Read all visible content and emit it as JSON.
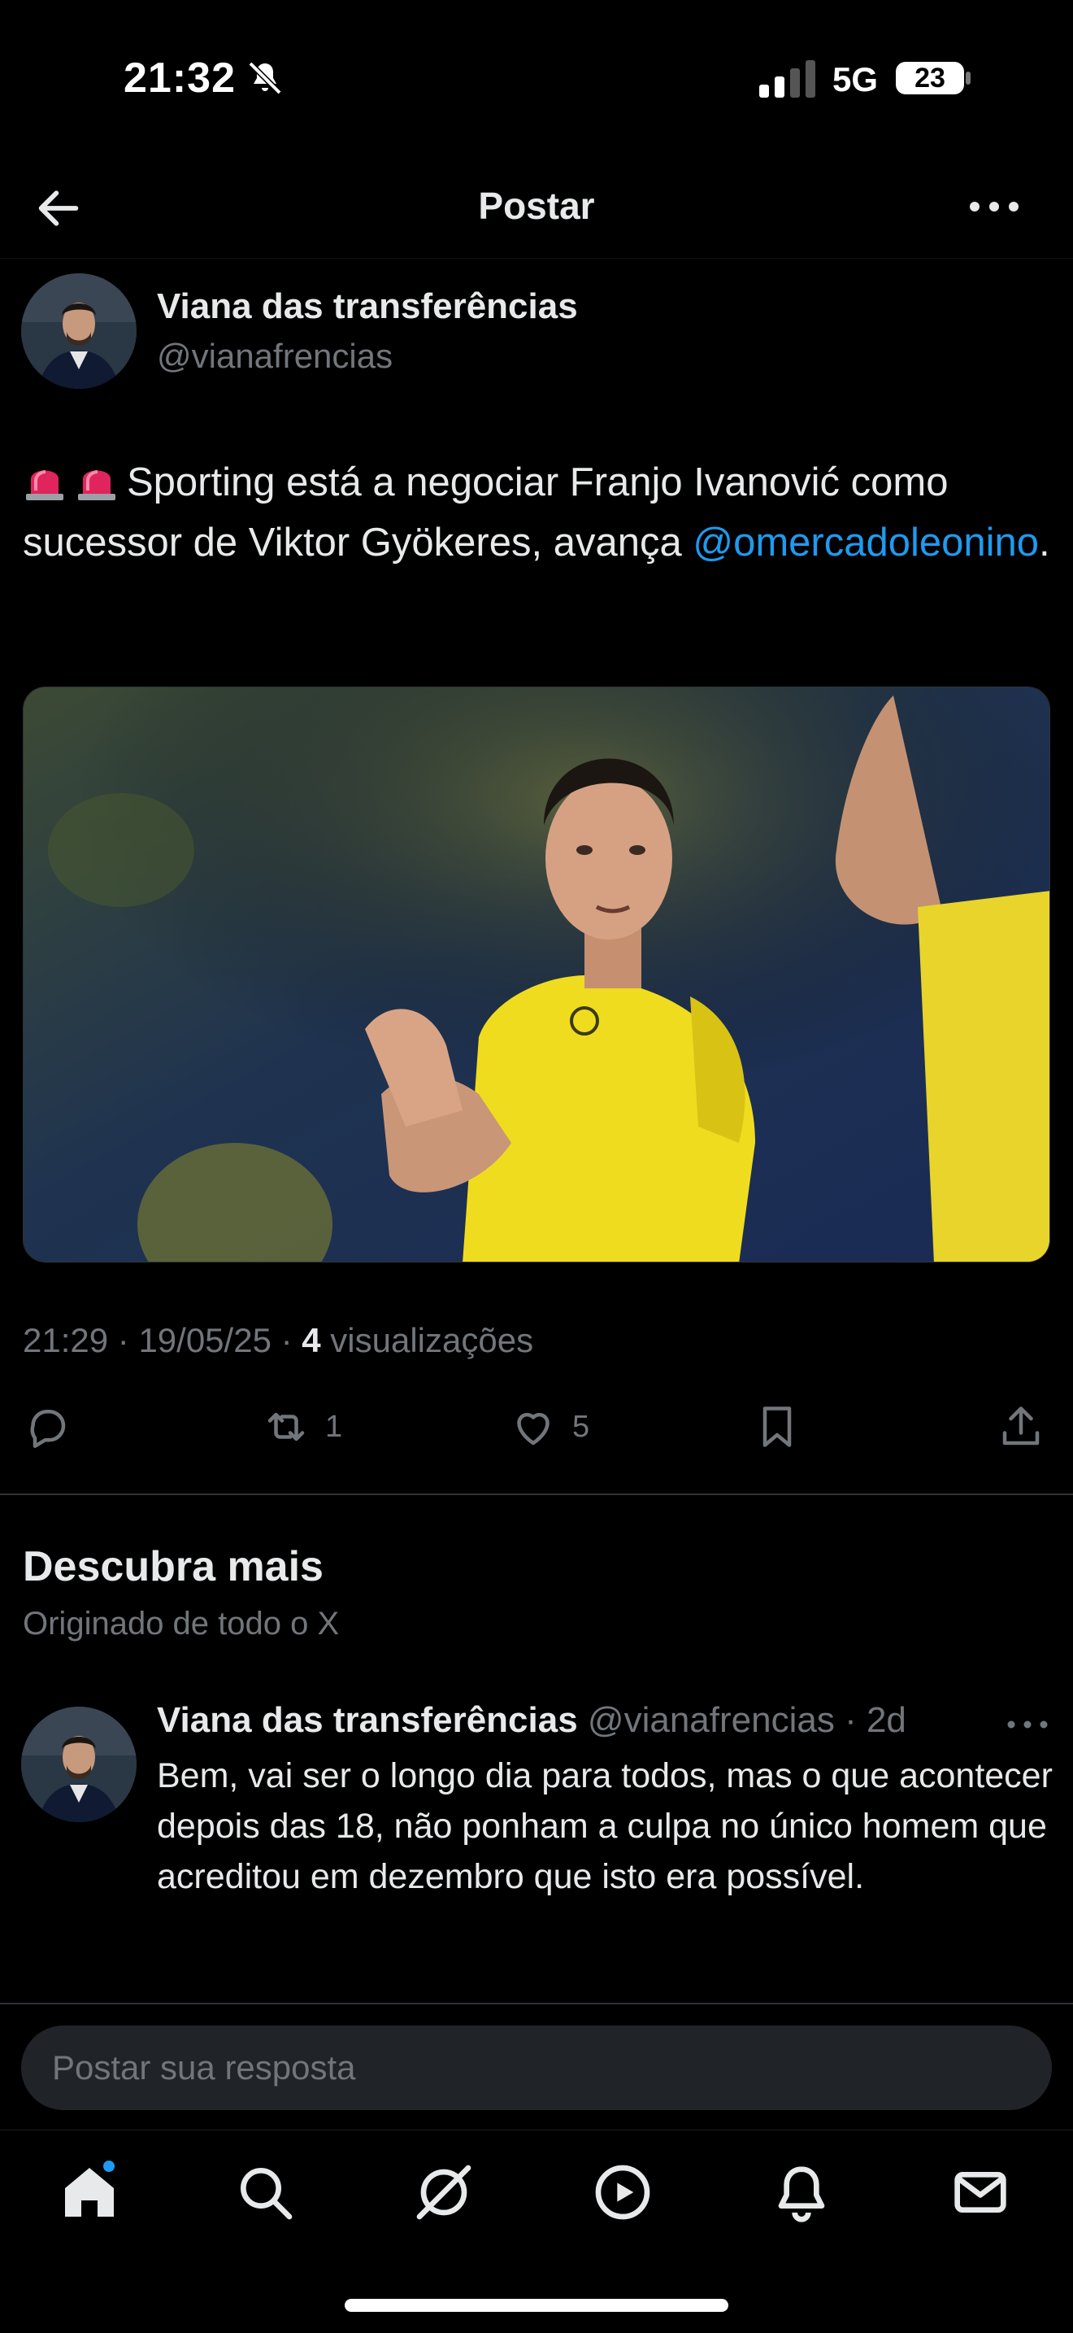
{
  "status_bar": {
    "time": "21:32",
    "network": "5G",
    "battery": "23"
  },
  "header": {
    "title": "Postar"
  },
  "tweet": {
    "author_name": "Viana das transferências",
    "author_handle": "@vianafrencias",
    "text_main": "Sporting está a negociar Franjo Ivanović como sucessor de Viktor Gyökeres, avança",
    "mention": "@omercadoleonino",
    "text_end": ".",
    "time": "21:29",
    "date": "19/05/25",
    "views_count": "4",
    "views_label": "visualizações",
    "retweets": "1",
    "likes": "5"
  },
  "discover": {
    "title": "Descubra mais",
    "subtitle": "Originado de todo o X"
  },
  "reply": {
    "author_name": "Viana das transferências",
    "author_handle": "@vianafrencias",
    "age": "2d",
    "text": "Bem, vai ser o longo dia para todos, mas o que acontecer depois das 18, não ponham a culpa no único homem que acreditou em dezembro que isto era possível."
  },
  "composer": {
    "placeholder": "Postar sua resposta"
  },
  "nav": {
    "items": [
      "home-icon",
      "search-icon",
      "grok-icon",
      "video-icon",
      "notifications-icon",
      "messages-icon"
    ],
    "active": "home-icon"
  },
  "colors": {
    "accent": "#1d9bf0",
    "background": "#000000",
    "muted": "#71767b",
    "text": "#e7e9ea"
  }
}
